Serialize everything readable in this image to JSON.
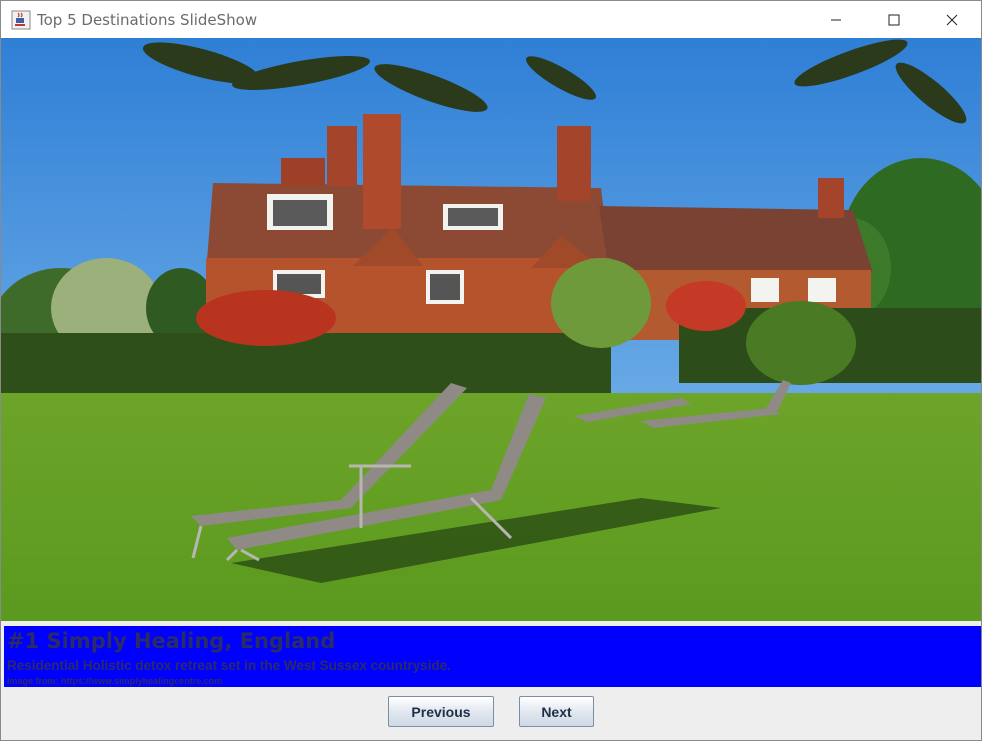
{
  "window": {
    "title": "Top 5 Destinations SlideShow",
    "icon": "java-cup-icon",
    "controls": [
      "minimize-icon",
      "maximize-icon",
      "close-icon"
    ]
  },
  "slide": {
    "image_description_icon": "country-house-photo",
    "title": "#1 Simply Healing, England",
    "description": "Residential Holistic detox retreat set in the West Sussex countryside.",
    "source": "Image from: https://www.simplyhealingcentre.com"
  },
  "buttons": {
    "previous": "Previous",
    "next": "Next"
  },
  "colors": {
    "caption_background": "#0000ff",
    "caption_text": "#2b2b66"
  }
}
